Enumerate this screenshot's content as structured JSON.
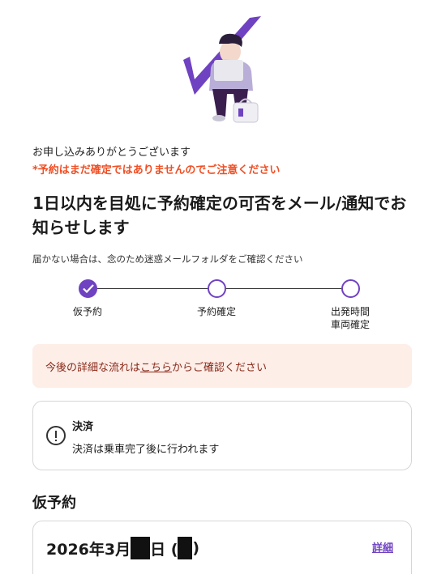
{
  "hero": {
    "illustration": "person-with-laptop-checkmark",
    "accent": "#6f42c1"
  },
  "thanks_text": "お申し込みありがとうございます",
  "warning_text": "*予約はまだ確定ではありませんのでご注意ください",
  "headline": "1日以内を目処に予約確定の可否をメール/通知でお知らせします",
  "note": "届かない場合は、念のため迷惑メールフォルダをご確認ください",
  "stepper": {
    "steps": [
      {
        "label": "仮予約",
        "done": true
      },
      {
        "label": "予約確定",
        "done": false
      },
      {
        "label_line1": "出発時間",
        "label_line2": "車両確定",
        "done": false
      }
    ]
  },
  "info_banner": {
    "prefix": "今後の詳細な流れは",
    "link": "こちら",
    "suffix": "からご確認ください"
  },
  "payment": {
    "title": "決済",
    "description": "決済は乗車完了後に行われます"
  },
  "booking": {
    "section_title": "仮予約",
    "date_prefix": "2026年3月",
    "date_day_suffix": "日 (",
    "date_close": ")",
    "detail_label": "詳細"
  },
  "colors": {
    "accent": "#6f42c1",
    "warning": "#f04e23",
    "banner_bg": "#fdeee8"
  }
}
